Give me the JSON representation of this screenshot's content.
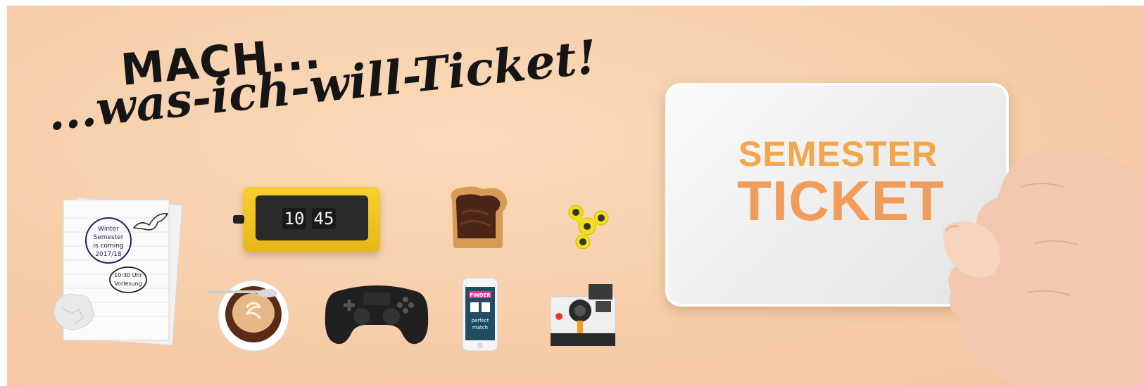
{
  "headline": {
    "line1": "MACH...",
    "line2": "...was-ich-will-Ticket!"
  },
  "ticket": {
    "line1": "SEMESTER",
    "line2": "TICKET"
  },
  "notes": {
    "circle_text": [
      "Winter",
      "Semester",
      "is coming",
      "2017/18"
    ],
    "oval_text": [
      "10:30 Uhr",
      "Vorlesung"
    ]
  },
  "clock": {
    "hour": "10",
    "minute": "45"
  },
  "phone": {
    "app_title": "FINDER",
    "caption": [
      "perfect",
      "match"
    ]
  },
  "colors": {
    "background": "#f7ceaa",
    "ticket_text": "#f2a64e",
    "clock_yellow": "#f1c424"
  }
}
